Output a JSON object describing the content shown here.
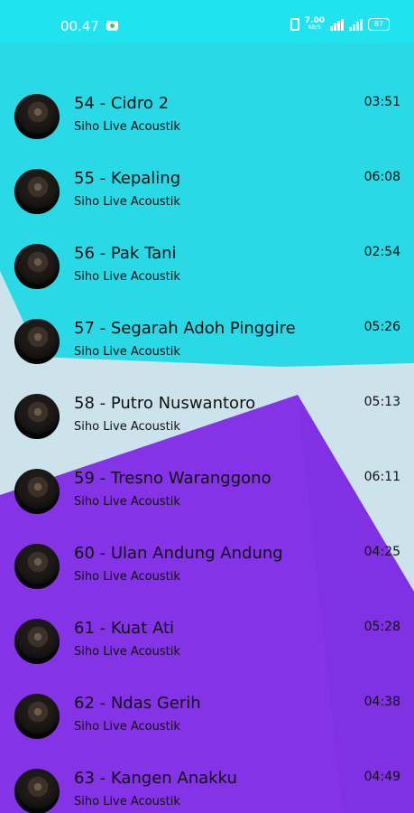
{
  "status_bar": {
    "time": "00.47",
    "speed_value": "7.00",
    "speed_unit": "KB/S",
    "battery": "87"
  },
  "songs": [
    {
      "title": "54 - Cidro 2",
      "artist": "Siho Live Acoustik",
      "duration": "03:51"
    },
    {
      "title": "55 - Kepaling",
      "artist": "Siho Live Acoustik",
      "duration": "06:08"
    },
    {
      "title": "56 - Pak Tani",
      "artist": "Siho Live Acoustik",
      "duration": "02:54"
    },
    {
      "title": "57 - Segarah Adoh Pinggire",
      "artist": "Siho Live Acoustik",
      "duration": "05:26"
    },
    {
      "title": "58 - Putro Nuswantoro",
      "artist": "Siho Live Acoustik",
      "duration": "05:13"
    },
    {
      "title": "59 - Tresno Waranggono",
      "artist": "Siho Live Acoustik",
      "duration": "06:11"
    },
    {
      "title": "60 - Ulan Andung Andung",
      "artist": "Siho Live Acoustik",
      "duration": "04:25"
    },
    {
      "title": "61 - Kuat Ati",
      "artist": "Siho Live Acoustik",
      "duration": "05:28"
    },
    {
      "title": "62 - Ndas Gerih",
      "artist": "Siho Live Acoustik",
      "duration": "04:38"
    },
    {
      "title": "63 - Kangen Anakku",
      "artist": "Siho Live Acoustik",
      "duration": "04:49"
    }
  ],
  "icons": {
    "status_message": "message-icon",
    "vibrate": "vibrate-icon",
    "wifi": "wifi-icon",
    "signal": "signal-icon",
    "battery": "battery-icon"
  },
  "colors": {
    "status_bar": "#1fe3ef",
    "cyan_panel": "#2ad9e6",
    "light_panel": "#cde3ec",
    "purple_panel": "#8433e6",
    "text": "#111111"
  }
}
